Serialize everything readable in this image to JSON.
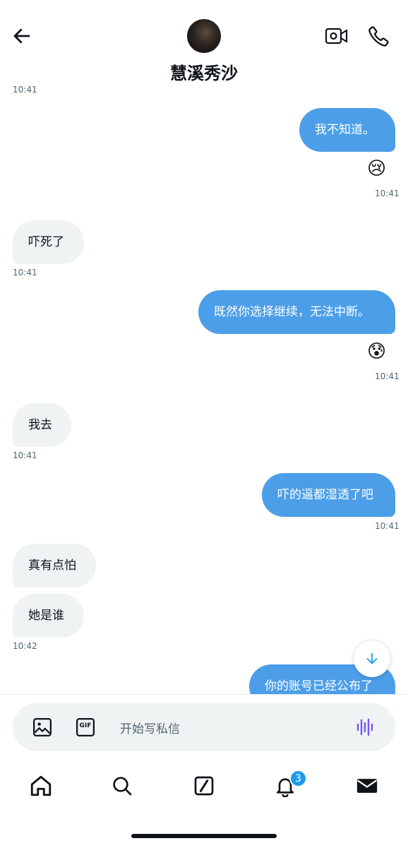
{
  "header": {
    "title": "慧溪秀沙",
    "back_icon": "arrow-left-icon",
    "video_icon": "video-camera-icon",
    "call_icon": "phone-icon"
  },
  "messages": [
    {
      "text": "10:41"
    },
    {
      "text": "我不知道。",
      "direction": "out"
    },
    {
      "text": "😢"
    },
    {
      "text": "10:41"
    },
    {
      "text": "吓死了",
      "direction": "in"
    },
    {
      "text": "10:41"
    },
    {
      "text": "既然你选择继续，无法中断。",
      "direction": "out"
    },
    {
      "text": "😰"
    },
    {
      "text": "10:41"
    },
    {
      "text": "我去",
      "direction": "in"
    },
    {
      "text": "10:41"
    },
    {
      "text": "吓的逼都湿透了吧",
      "direction": "out"
    },
    {
      "text": "10:41"
    },
    {
      "text": "真有点怕",
      "direction": "in"
    },
    {
      "text": "她是谁",
      "direction": "in"
    },
    {
      "text": "10:42"
    },
    {
      "text": "你的账号已经公布了",
      "direction": "out"
    }
  ],
  "composer": {
    "placeholder": "开始写私信",
    "gif_label": "GIF",
    "icons": [
      "image-icon",
      "gif-icon",
      "voice-wave-icon"
    ]
  },
  "nav": {
    "items": [
      "home-icon",
      "search-icon",
      "grok-icon",
      "bell-icon",
      "mail-icon"
    ],
    "notification_badge": "3"
  },
  "colors": {
    "outgoing_bubble": "#4c9ee8",
    "incoming_bubble": "#eff3f4",
    "accent": "#1d9bf0",
    "voice_icon": "#7856ff"
  }
}
